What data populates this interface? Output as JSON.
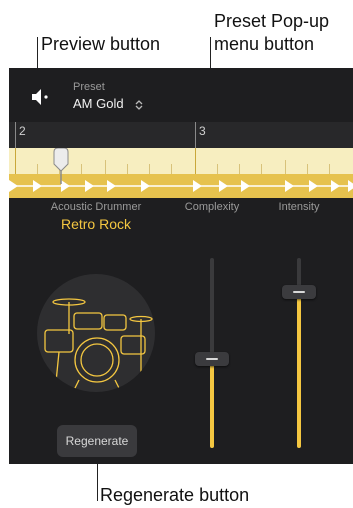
{
  "callouts": {
    "preview": "Preview button",
    "preset_line1": "Preset Pop-up",
    "preset_line2": "menu button",
    "regenerate": "Regenerate button"
  },
  "preset": {
    "caption": "Preset",
    "value": "AM Gold"
  },
  "ruler": {
    "marks": [
      "2",
      "3"
    ]
  },
  "drummer": {
    "caption": "Acoustic Drummer",
    "style": "Retro Rock"
  },
  "sliders": {
    "complexity": {
      "label": "Complexity",
      "value": 0.47
    },
    "intensity": {
      "label": "Intensity",
      "value": 0.82
    }
  },
  "buttons": {
    "regenerate": "Regenerate"
  },
  "colors": {
    "accent": "#f4c741",
    "panel": "#1e1e20"
  },
  "icons": {
    "preview": "speaker-icon",
    "preset_menu": "chevron-up-down-icon"
  }
}
